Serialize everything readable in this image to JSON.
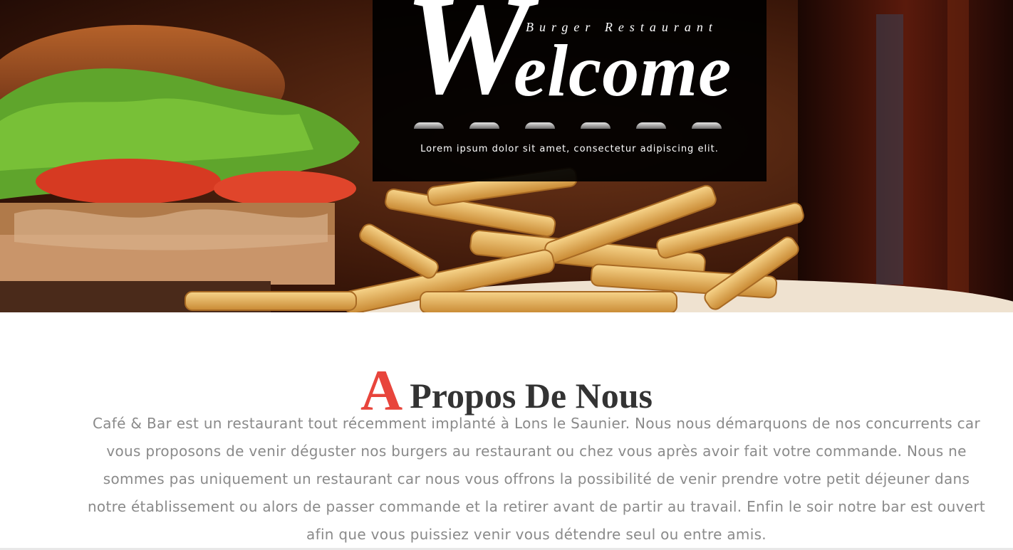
{
  "hero": {
    "big_letter": "W",
    "word_rest": "elcome",
    "subtitle": "Burger Restaurant",
    "tagline": "Lorem ipsum dolor sit amet, consectetur adipiscing elit.",
    "photo": "burger-and-fries-photo"
  },
  "about": {
    "title_cap": "A",
    "title_rest": "Propos De Nous",
    "text": "Café & Bar est un restaurant tout récemment implanté à Lons le Saunier. Nous nous démarquons de nos concurrents car vous proposons de venir déguster nos burgers au restaurant ou chez vous après avoir fait votre commande. Nous ne sommes pas uniquement un restaurant car nous vous offrons la possibilité de venir prendre votre petit déjeuner dans notre établissement ou alors de passer commande et la retirer avant de partir au travail. Enfin le soir notre bar est ouvert afin que vous puissiez venir vous détendre seul ou entre amis."
  },
  "colors": {
    "accent": "#e8453c",
    "title_text": "#333333",
    "body_text": "#8a8a8a",
    "overlay": "#000000"
  }
}
